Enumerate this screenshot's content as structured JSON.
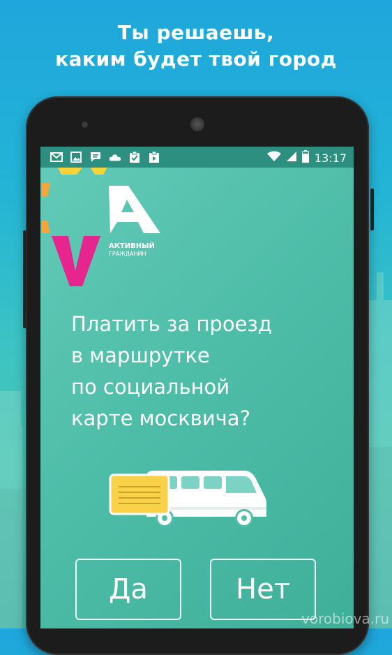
{
  "promo": {
    "headline_line1": "Ты решаешь,",
    "headline_line2": "каким будет твой город"
  },
  "status_bar": {
    "time": "13:17",
    "left_icons": [
      "gmail-icon",
      "gallery-icon",
      "chat-icon",
      "cloud-icon",
      "clipboard-check-icon",
      "media-icon"
    ],
    "right_icons": [
      "wifi-icon",
      "signal-icon",
      "battery-icon"
    ]
  },
  "app": {
    "logo_line1": "АКТИВНЫЙ",
    "logo_line2": "ГРАЖДАНИН",
    "question_lines": [
      "Платить за проезд",
      "в маршрутке",
      "по социальной",
      "карте москвича?"
    ],
    "yes_label": "Да",
    "no_label": "Нет"
  },
  "watermark": "vorobiova.ru",
  "colors": {
    "screen_teal": "#4fbea9",
    "status_bar": "#2d8f80",
    "logo_pink": "#e6258f",
    "logo_orange": "#f4a63a",
    "logo_yellow": "#f7d43a",
    "card_yellow": "#f9d24a"
  }
}
